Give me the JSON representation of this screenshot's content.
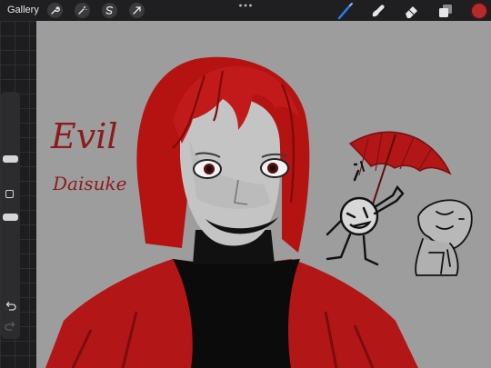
{
  "app": {
    "gallery_label": "Gallery"
  },
  "toolbar_left": [
    "wrench-icon",
    "magic-wand-icon",
    "selection-icon",
    "transform-arrow-icon"
  ],
  "toolbar_right": [
    "brush-icon",
    "smudge-icon",
    "eraser-icon",
    "layers-icon"
  ],
  "colors": {
    "active_color": "#b52a2a",
    "brush_blue": "#2f7bf5",
    "canvas_bg": "#9d9d9d"
  },
  "canvas": {
    "title_line1": "Evil",
    "title_line2": "Daisuke"
  }
}
